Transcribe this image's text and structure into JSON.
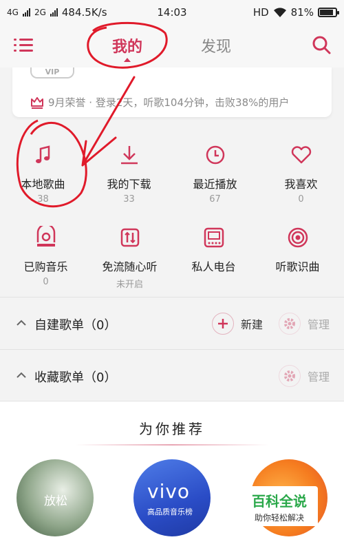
{
  "status_bar": {
    "network1": "4G",
    "network2": "2G",
    "speed": "484.5K/s",
    "time": "14:03",
    "hd": "HD",
    "battery": "81%",
    "battery_level": 0.81
  },
  "header": {
    "tabs": [
      {
        "label": "我的",
        "active": true
      },
      {
        "label": "发现",
        "active": false
      }
    ],
    "icons": {
      "menu": "menu-icon",
      "search": "search-icon"
    },
    "accent": "#d0365a"
  },
  "profile": {
    "vip": "VIP",
    "honor_text": "9月荣誉 · 登录2天，听歌104分钟，击败38%的用户"
  },
  "quick_items": [
    {
      "label": "本地歌曲",
      "count": "38",
      "icon": "music-note-icon"
    },
    {
      "label": "我的下载",
      "count": "33",
      "icon": "download-icon"
    },
    {
      "label": "最近播放",
      "count": "67",
      "icon": "clock-icon"
    },
    {
      "label": "我喜欢",
      "count": "0",
      "icon": "heart-icon"
    },
    {
      "label": "已购音乐",
      "count": "0",
      "icon": "purchased-music-icon"
    },
    {
      "label": "免流随心听",
      "count": "未开启",
      "icon": "data-free-icon"
    },
    {
      "label": "私人电台",
      "count": "",
      "icon": "radio-icon"
    },
    {
      "label": "听歌识曲",
      "count": "",
      "icon": "recognize-song-icon"
    }
  ],
  "playlists": {
    "created": {
      "title": "自建歌单（0）",
      "new_label": "新建",
      "manage_label": "管理"
    },
    "collected": {
      "title": "收藏歌单（0）",
      "manage_label": "管理"
    }
  },
  "recommend": {
    "title": "为你推荐",
    "items": [
      {
        "label": "放松"
      },
      {
        "label": "vivo",
        "sub": "高品质音乐榜"
      },
      {
        "label": ""
      }
    ]
  },
  "watermark": {
    "big": "百科全说",
    "small": "助你轻松解决"
  }
}
